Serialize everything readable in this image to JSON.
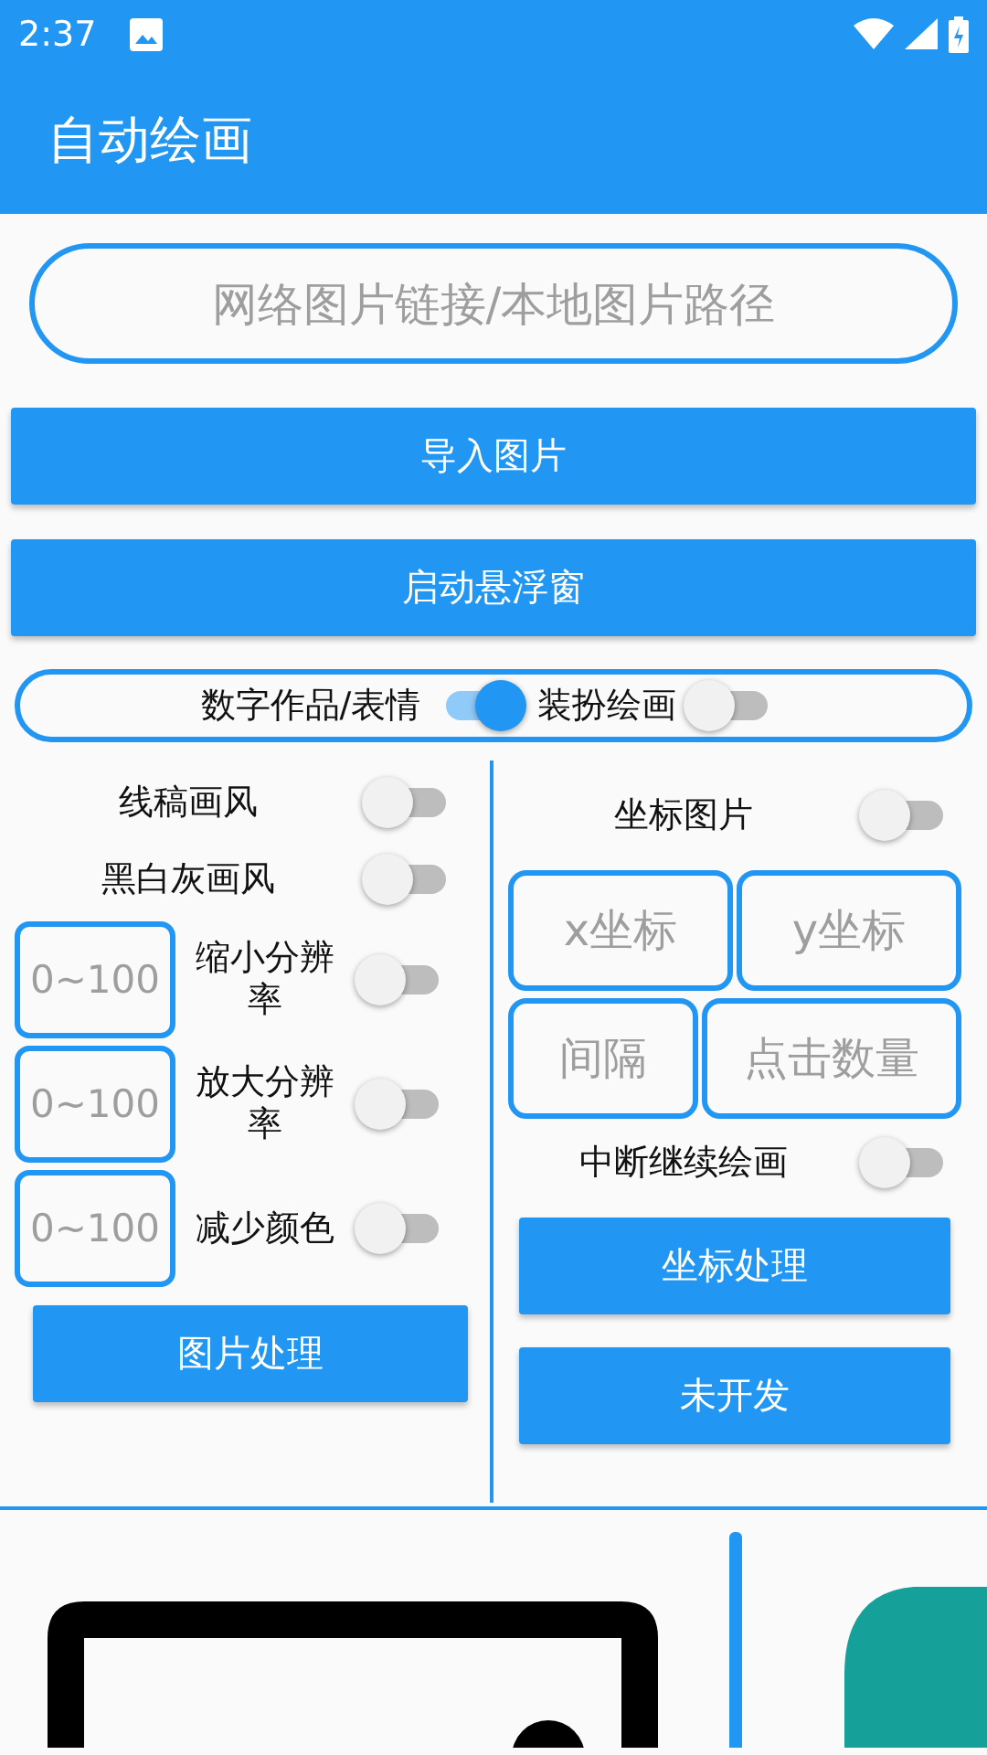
{
  "status_bar": {
    "time": "2:37"
  },
  "app_bar": {
    "title": "自动绘画"
  },
  "url_field": {
    "placeholder": "网络图片链接/本地图片路径"
  },
  "buttons": [
    "导入图片",
    "启动悬浮窗"
  ],
  "mode_switches": [
    {
      "label": "数字作品/表情",
      "on": true
    },
    {
      "label": "装扮绘画",
      "on": false
    }
  ],
  "left_panel": {
    "rows": [
      {
        "kind": "switch",
        "label": "线稿画风",
        "on": false
      },
      {
        "kind": "switch",
        "label": "黑白灰画风",
        "on": false
      },
      {
        "kind": "input_switch",
        "placeholder": "0~100",
        "label": "缩小分辨率",
        "on": false
      },
      {
        "kind": "input_switch",
        "placeholder": "0~100",
        "label": "放大分辨率",
        "on": false
      },
      {
        "kind": "input_switch",
        "placeholder": "0~100",
        "label": "减少颜色",
        "on": false
      }
    ],
    "button": "图片处理"
  },
  "right_panel": {
    "image_switch": {
      "label": "坐标图片",
      "on": false
    },
    "field_rows": [
      [
        {
          "placeholder": "x坐标"
        },
        {
          "placeholder": "y坐标"
        }
      ],
      [
        {
          "placeholder": "间隔"
        },
        {
          "placeholder": "点击数量"
        }
      ]
    ],
    "resume_switch": {
      "label": "中断继续绘画",
      "on": false
    },
    "buttons": [
      "坐标处理",
      "未开发"
    ]
  }
}
